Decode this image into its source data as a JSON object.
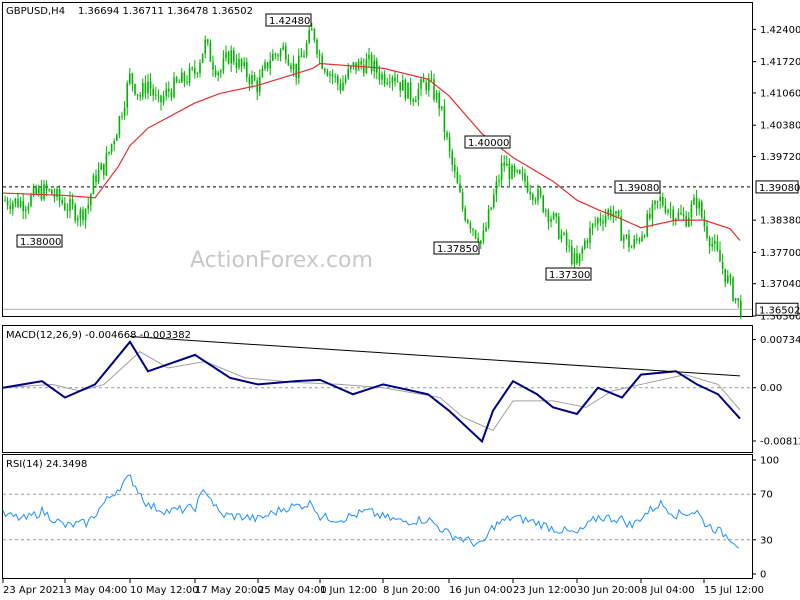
{
  "header": {
    "symbol": "GBPUSD,H4",
    "ohlc": "1.36694 1.36711 1.36478 1.36502"
  },
  "watermark": "ActionForex.com",
  "colors": {
    "candle": "#00b400",
    "ma": "#e03030",
    "macd": "#000080",
    "signal": "#a0a0a0",
    "rsi": "#1e90ff",
    "trendline": "#000000",
    "grid": "#b0b0b0"
  },
  "chart_data": [
    {
      "type": "candlestick",
      "title": "GBPUSD,H4",
      "y_ticks": [
        "1.42400",
        "1.41720",
        "1.41060",
        "1.40380",
        "1.39720",
        "1.38380",
        "1.37700",
        "1.37040",
        "1.36360"
      ],
      "ylim": [
        1.3636,
        1.4285
      ],
      "x_ticks": [
        "23 Apr 2021",
        "3 May 04:00",
        "10 May 12:00",
        "17 May 20:00",
        "25 May 04:00",
        "1 Jun 12:00",
        "8 Jun 20:00",
        "16 Jun 04:00",
        "23 Jun 12:00",
        "30 Jun 20:00",
        "8 Jul 04:00",
        "15 Jul 12:00"
      ],
      "price_path": [
        {
          "x": "23 Apr 2021",
          "y": 1.388
        },
        {
          "x": "27 Apr",
          "y": 1.3875
        },
        {
          "x": "29 Apr",
          "y": 1.39
        },
        {
          "x": "30 Apr",
          "y": 1.3895
        },
        {
          "x": "3 May 04:00",
          "y": 1.387
        },
        {
          "x": "4 May",
          "y": 1.385
        },
        {
          "x": "5 May",
          "y": 1.387
        },
        {
          "x": "6 May",
          "y": 1.393
        },
        {
          "x": "7 May",
          "y": 1.395
        },
        {
          "x": "9 May",
          "y": 1.404
        },
        {
          "x": "10 May 12:00",
          "y": 1.414
        },
        {
          "x": "11 May",
          "y": 1.41
        },
        {
          "x": "12 May",
          "y": 1.413
        },
        {
          "x": "13 May",
          "y": 1.408
        },
        {
          "x": "14 May",
          "y": 1.411
        },
        {
          "x": "17 May 20:00",
          "y": 1.415
        },
        {
          "x": "18 May",
          "y": 1.421
        },
        {
          "x": "19 May",
          "y": 1.417
        },
        {
          "x": "20 May",
          "y": 1.415
        },
        {
          "x": "21 May",
          "y": 1.419
        },
        {
          "x": "24 May",
          "y": 1.415
        },
        {
          "x": "25 May 04:00",
          "y": 1.412
        },
        {
          "x": "26 May",
          "y": 1.418
        },
        {
          "x": "27 May",
          "y": 1.42
        },
        {
          "x": "28 May",
          "y": 1.415
        },
        {
          "x": "31 May",
          "y": 1.424
        },
        {
          "x": "1 Jun 12:00",
          "y": 1.418
        },
        {
          "x": "2 Jun",
          "y": 1.415
        },
        {
          "x": "3 Jun",
          "y": 1.412
        },
        {
          "x": "4 Jun",
          "y": 1.416
        },
        {
          "x": "7 Jun",
          "y": 1.417
        },
        {
          "x": "8 Jun 20:00",
          "y": 1.414
        },
        {
          "x": "9 Jun",
          "y": 1.415
        },
        {
          "x": "10 Jun",
          "y": 1.412
        },
        {
          "x": "11 Jun",
          "y": 1.41
        },
        {
          "x": "14 Jun",
          "y": 1.413
        },
        {
          "x": "15 Jun",
          "y": 1.408
        },
        {
          "x": "16 Jun 04:00",
          "y": 1.398
        },
        {
          "x": "17 Jun",
          "y": 1.386
        },
        {
          "x": "18 Jun",
          "y": 1.379
        },
        {
          "x": "21 Jun",
          "y": 1.388
        },
        {
          "x": "22 Jun",
          "y": 1.396
        },
        {
          "x": "23 Jun 12:00",
          "y": 1.393
        },
        {
          "x": "24 Jun",
          "y": 1.392
        },
        {
          "x": "25 Jun",
          "y": 1.389
        },
        {
          "x": "28 Jun",
          "y": 1.384
        },
        {
          "x": "29 Jun",
          "y": 1.379
        },
        {
          "x": "30 Jun 20:00",
          "y": 1.374
        },
        {
          "x": "1 Jul",
          "y": 1.38
        },
        {
          "x": "2 Jul",
          "y": 1.384
        },
        {
          "x": "5 Jul",
          "y": 1.386
        },
        {
          "x": "6 Jul",
          "y": 1.381
        },
        {
          "x": "7 Jul",
          "y": 1.378
        },
        {
          "x": "8 Jul 04:00",
          "y": 1.381
        },
        {
          "x": "9 Jul",
          "y": 1.388
        },
        {
          "x": "12 Jul",
          "y": 1.385
        },
        {
          "x": "13 Jul",
          "y": 1.384
        },
        {
          "x": "14 Jul",
          "y": 1.388
        },
        {
          "x": "15 Jul 12:00",
          "y": 1.383
        },
        {
          "x": "16 Jul",
          "y": 1.376
        },
        {
          "x": "19 Jul",
          "y": 1.37
        },
        {
          "x": "20 Jul",
          "y": 1.3652
        }
      ],
      "moving_average": [
        {
          "x": "23 Apr 2021",
          "y": 1.3895
        },
        {
          "x": "3 May 04:00",
          "y": 1.389
        },
        {
          "x": "6 May",
          "y": 1.3885
        },
        {
          "x": "9 May",
          "y": 1.395
        },
        {
          "x": "10 May 12:00",
          "y": 1.3995
        },
        {
          "x": "12 May",
          "y": 1.4032
        },
        {
          "x": "17 May 20:00",
          "y": 1.4085
        },
        {
          "x": "20 May",
          "y": 1.4105
        },
        {
          "x": "25 May 04:00",
          "y": 1.4122
        },
        {
          "x": "31 May",
          "y": 1.4158
        },
        {
          "x": "1 Jun 12:00",
          "y": 1.4168
        },
        {
          "x": "8 Jun 20:00",
          "y": 1.4158
        },
        {
          "x": "14 Jun",
          "y": 1.4135
        },
        {
          "x": "16 Jun 04:00",
          "y": 1.41
        },
        {
          "x": "18 Jun",
          "y": 1.402
        },
        {
          "x": "23 Jun 12:00",
          "y": 1.397
        },
        {
          "x": "28 Jun",
          "y": 1.392
        },
        {
          "x": "30 Jun 20:00",
          "y": 1.388
        },
        {
          "x": "2 Jul",
          "y": 1.386
        },
        {
          "x": "6 Jul",
          "y": 1.384
        },
        {
          "x": "8 Jul 04:00",
          "y": 1.3822
        },
        {
          "x": "12 Jul",
          "y": 1.3838
        },
        {
          "x": "15 Jul 12:00",
          "y": 1.3838
        },
        {
          "x": "19 Jul",
          "y": 1.382
        },
        {
          "x": "20 Jul",
          "y": 1.3795
        }
      ],
      "horizontal_level": {
        "value": 1.3908,
        "label": "1.39080",
        "style": "dashed"
      },
      "current_price": {
        "value": 1.36502,
        "label": "1.36502"
      },
      "annotations": [
        {
          "label": "1.42480",
          "x": "31 May",
          "y": 1.4248
        },
        {
          "label": "1.38000",
          "x": "5 May",
          "y": 1.38
        },
        {
          "label": "1.40000",
          "x": "22 Jun",
          "y": 1.4
        },
        {
          "label": "1.37850",
          "x": "18 Jun",
          "y": 1.3785
        },
        {
          "label": "1.37300",
          "x": "30 Jun 20:00",
          "y": 1.373
        },
        {
          "label": "1.39080",
          "x": "9 Jul",
          "y": 1.3908
        }
      ],
      "grid": false
    },
    {
      "type": "line",
      "title": "MACD(12,26,9) -0.004668 -0.003382",
      "y_ticks": [
        "0.007342",
        "0.00",
        "-0.008126"
      ],
      "ylim": [
        -0.0095,
        0.0088
      ],
      "series": [
        {
          "name": "MACD",
          "values": [
            {
              "x": "23 Apr 2021",
              "y": 0.0
            },
            {
              "x": "29 Apr",
              "y": 0.001
            },
            {
              "x": "3 May 04:00",
              "y": -0.0015
            },
            {
              "x": "6 May",
              "y": 0.0005
            },
            {
              "x": "10 May 12:00",
              "y": 0.007
            },
            {
              "x": "12 May",
              "y": 0.0025
            },
            {
              "x": "17 May 20:00",
              "y": 0.005
            },
            {
              "x": "21 May",
              "y": 0.0015
            },
            {
              "x": "25 May 04:00",
              "y": 0.0005
            },
            {
              "x": "28 May",
              "y": 0.001
            },
            {
              "x": "1 Jun 12:00",
              "y": 0.0012
            },
            {
              "x": "4 Jun",
              "y": -0.001
            },
            {
              "x": "8 Jun 20:00",
              "y": 0.0005
            },
            {
              "x": "14 Jun",
              "y": -0.001
            },
            {
              "x": "16 Jun 04:00",
              "y": -0.0035
            },
            {
              "x": "18 Jun",
              "y": -0.0082
            },
            {
              "x": "21 Jun",
              "y": -0.0035
            },
            {
              "x": "23 Jun 12:00",
              "y": 0.001
            },
            {
              "x": "25 Jun",
              "y": -0.001
            },
            {
              "x": "28 Jun",
              "y": -0.003
            },
            {
              "x": "30 Jun 20:00",
              "y": -0.004
            },
            {
              "x": "2 Jul",
              "y": 0.0
            },
            {
              "x": "6 Jul",
              "y": -0.0015
            },
            {
              "x": "8 Jul 04:00",
              "y": 0.002
            },
            {
              "x": "12 Jul",
              "y": 0.0025
            },
            {
              "x": "14 Jul",
              "y": 0.0005
            },
            {
              "x": "16 Jul",
              "y": -0.001
            },
            {
              "x": "20 Jul",
              "y": -0.0047
            }
          ]
        },
        {
          "name": "Signal",
          "values": [
            {
              "x": "23 Apr 2021",
              "y": 0.0
            },
            {
              "x": "30 Apr",
              "y": 0.0005
            },
            {
              "x": "4 May",
              "y": -0.0005
            },
            {
              "x": "7 May",
              "y": 0.0005
            },
            {
              "x": "11 May",
              "y": 0.0055
            },
            {
              "x": "14 May",
              "y": 0.003
            },
            {
              "x": "18 May",
              "y": 0.004
            },
            {
              "x": "24 May",
              "y": 0.0015
            },
            {
              "x": "28 May",
              "y": 0.0008
            },
            {
              "x": "3 Jun",
              "y": 0.0005
            },
            {
              "x": "8 Jun 20:00",
              "y": 0.0
            },
            {
              "x": "15 Jun",
              "y": -0.0015
            },
            {
              "x": "17 Jun",
              "y": -0.0045
            },
            {
              "x": "21 Jun",
              "y": -0.0065
            },
            {
              "x": "23 Jun 12:00",
              "y": -0.002
            },
            {
              "x": "28 Jun",
              "y": -0.002
            },
            {
              "x": "1 Jul",
              "y": -0.003
            },
            {
              "x": "5 Jul",
              "y": -0.0005
            },
            {
              "x": "8 Jul 04:00",
              "y": 0.0005
            },
            {
              "x": "13 Jul",
              "y": 0.002
            },
            {
              "x": "16 Jul",
              "y": 0.0005
            },
            {
              "x": "20 Jul",
              "y": -0.0034
            }
          ]
        }
      ],
      "trendline": [
        {
          "x": "10 May 12:00",
          "y": 0.0078
        },
        {
          "x": "20 Jul",
          "y": 0.0018
        }
      ],
      "zero_line": true
    },
    {
      "type": "line",
      "title": "RSI(14) 24.3498",
      "y_ticks": [
        "100",
        "70",
        "30",
        "0"
      ],
      "ylim": [
        0,
        100
      ],
      "levels": [
        70,
        30
      ],
      "series": [
        {
          "name": "RSI(14)",
          "values": [
            {
              "x": "23 Apr 2021",
              "y": 52
            },
            {
              "x": "27 Apr",
              "y": 48
            },
            {
              "x": "29 Apr",
              "y": 55
            },
            {
              "x": "3 May 04:00",
              "y": 42
            },
            {
              "x": "5 May",
              "y": 45
            },
            {
              "x": "7 May",
              "y": 62
            },
            {
              "x": "9 May",
              "y": 75
            },
            {
              "x": "10 May 12:00",
              "y": 85
            },
            {
              "x": "12 May",
              "y": 60
            },
            {
              "x": "14 May",
              "y": 55
            },
            {
              "x": "17 May 20:00",
              "y": 58
            },
            {
              "x": "18 May",
              "y": 75
            },
            {
              "x": "20 May",
              "y": 52
            },
            {
              "x": "24 May",
              "y": 50
            },
            {
              "x": "25 May 04:00",
              "y": 48
            },
            {
              "x": "27 May",
              "y": 58
            },
            {
              "x": "31 May",
              "y": 62
            },
            {
              "x": "1 Jun 12:00",
              "y": 50
            },
            {
              "x": "3 Jun",
              "y": 48
            },
            {
              "x": "7 Jun",
              "y": 55
            },
            {
              "x": "8 Jun 20:00",
              "y": 50
            },
            {
              "x": "10 Jun",
              "y": 46
            },
            {
              "x": "14 Jun",
              "y": 48
            },
            {
              "x": "16 Jun 04:00",
              "y": 35
            },
            {
              "x": "18 Jun",
              "y": 25
            },
            {
              "x": "21 Jun",
              "y": 42
            },
            {
              "x": "23 Jun 12:00",
              "y": 50
            },
            {
              "x": "25 Jun",
              "y": 45
            },
            {
              "x": "28 Jun",
              "y": 40
            },
            {
              "x": "30 Jun 20:00",
              "y": 35
            },
            {
              "x": "2 Jul",
              "y": 50
            },
            {
              "x": "6 Jul",
              "y": 48
            },
            {
              "x": "7 Jul",
              "y": 42
            },
            {
              "x": "8 Jul 04:00",
              "y": 50
            },
            {
              "x": "9 Jul",
              "y": 62
            },
            {
              "x": "12 Jul",
              "y": 52
            },
            {
              "x": "14 Jul",
              "y": 55
            },
            {
              "x": "15 Jul 12:00",
              "y": 45
            },
            {
              "x": "19 Jul",
              "y": 32
            },
            {
              "x": "20 Jul",
              "y": 24.35
            }
          ]
        }
      ]
    }
  ]
}
